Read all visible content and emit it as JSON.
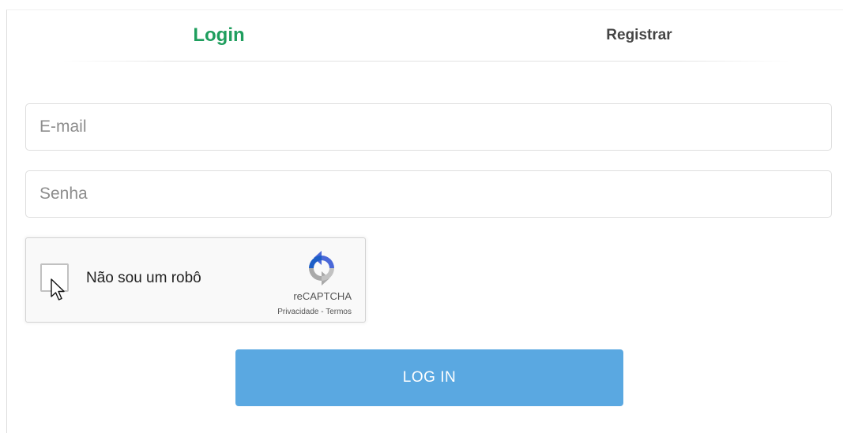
{
  "tabs": {
    "login": "Login",
    "register": "Registrar"
  },
  "form": {
    "email_placeholder": "E-mail",
    "email_value": "",
    "password_placeholder": "Senha",
    "password_value": ""
  },
  "recaptcha": {
    "label": "Não sou um robô",
    "brand": "reCAPTCHA",
    "privacy": "Privacidade",
    "separator": " - ",
    "terms": "Termos",
    "checked": false
  },
  "button": {
    "label": "LOG IN"
  },
  "colors": {
    "active_tab": "#1f9e5e",
    "inactive_tab": "#444444",
    "button_bg": "#5aa8e1",
    "button_text": "#ffffff"
  },
  "icons": {
    "recaptcha_logo": "recaptcha-logo-icon",
    "cursor": "mouse-pointer-icon"
  }
}
